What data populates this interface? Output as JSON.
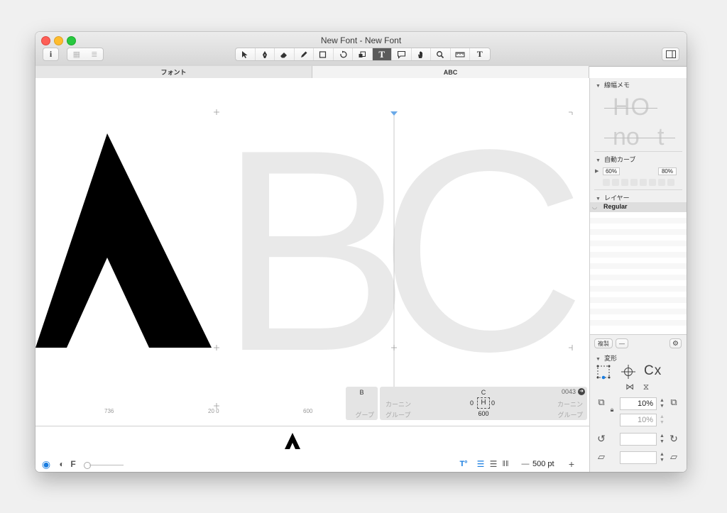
{
  "window": {
    "title": "New Font - New Font"
  },
  "toolbar": {
    "info_label": "i",
    "tools": [
      "select-tool",
      "pen-tool",
      "eraser-tool",
      "pencil-tool",
      "rectangle-tool",
      "rotate-tool",
      "scale-tool",
      "text-tool",
      "annotation-tool",
      "hand-tool",
      "zoom-tool",
      "measure-tool",
      "font-tool"
    ],
    "active_tool": "text-tool"
  },
  "tabs": [
    {
      "label": "フォント",
      "active": false
    },
    {
      "label": "ABC",
      "active": true
    }
  ],
  "canvas": {
    "glyph_a": "A",
    "glyph_b": "B",
    "glyph_c": "C",
    "metric_labels": [
      "736",
      "20 0",
      "600"
    ]
  },
  "info_panel": {
    "left_glyph": "B",
    "left_group": "グープ",
    "glyph_name": "C",
    "unicode": "0043",
    "kerning_label": "カーニン",
    "kerning_right": "カーニン",
    "group_label": "グループ",
    "group_right": "グループ",
    "lsb": "0",
    "rsb": "0",
    "width": "600"
  },
  "preview": {
    "glyph": "A"
  },
  "bottom": {
    "zoom_value": "500 pt",
    "minus": "—",
    "plus": "+",
    "f_label": "F"
  },
  "sidebar": {
    "stem_memo": {
      "title": "線幅メモ",
      "sample1": "HO",
      "sample2": "no",
      "sample3": "t"
    },
    "auto_kerning": {
      "title": "自動カーブ",
      "left_value": "60%",
      "right_value": "80%"
    },
    "layers": {
      "title": "レイヤー",
      "items": [
        "Regular"
      ]
    },
    "duplicate_button": "複製",
    "remove_button": "—",
    "transform": {
      "title": "変形",
      "cx_label": "Cx",
      "scale_x": "10%",
      "scale_y": "10%",
      "rotate_value": "",
      "slant_value": ""
    }
  },
  "colors": {
    "accent": "#1a7de0",
    "glyph_fill": "#000000",
    "background_glyph": "#e9e9e9"
  }
}
